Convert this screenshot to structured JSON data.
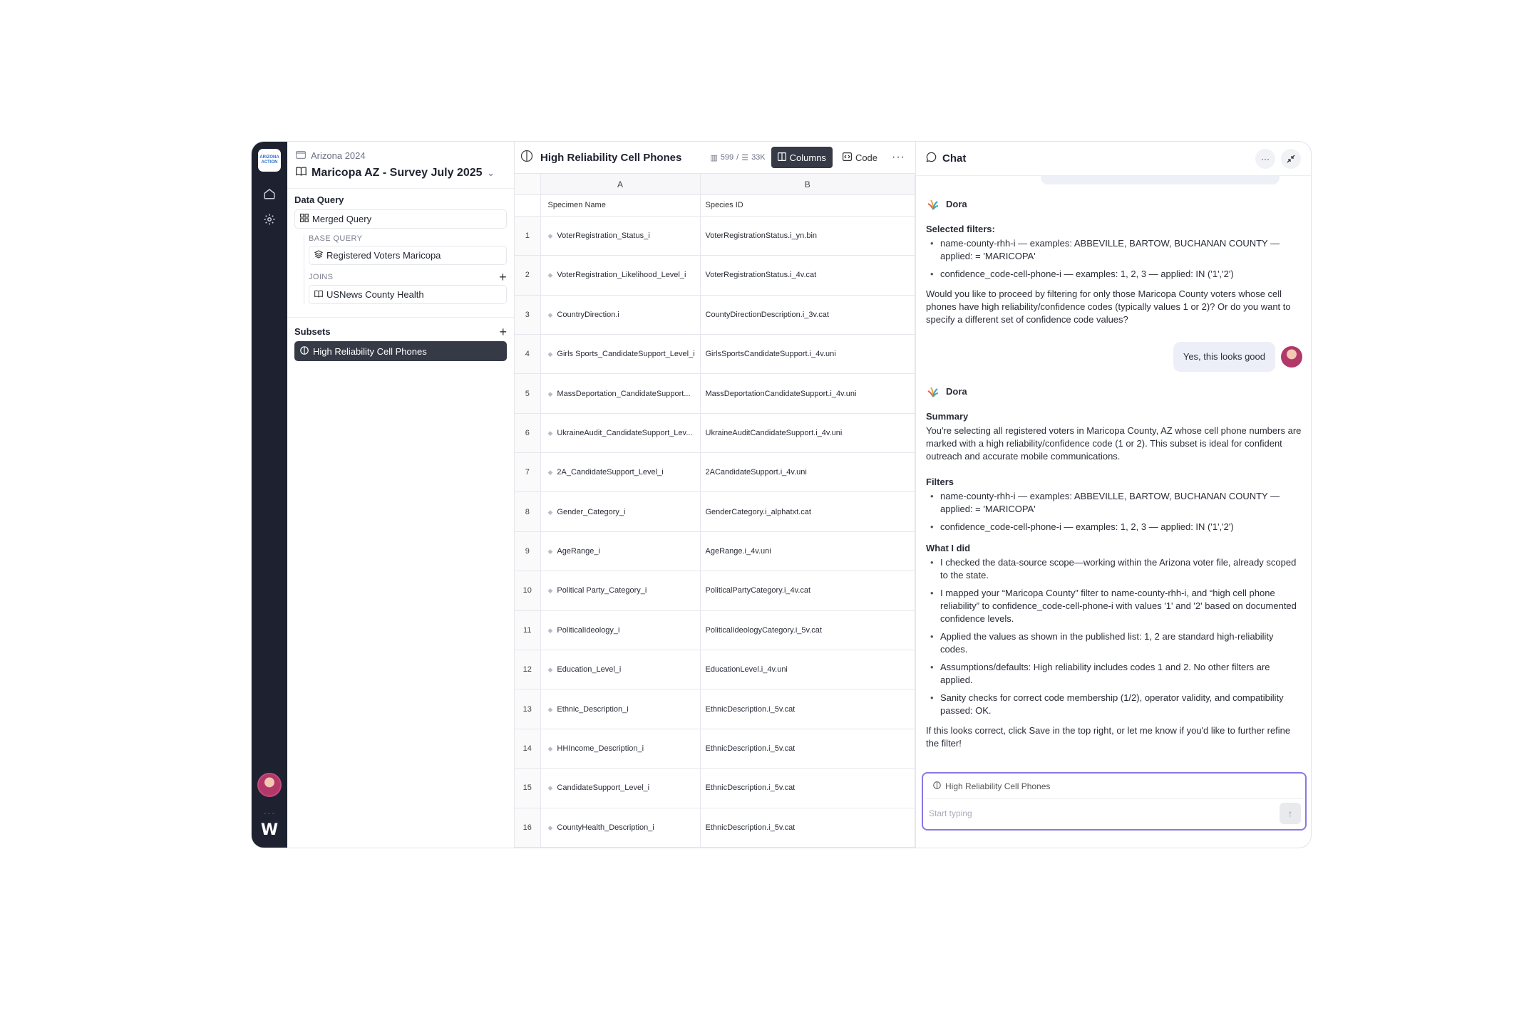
{
  "rail": {
    "logo_text": "ARIZONA ACTION",
    "nav": [
      "home-icon",
      "settings-icon"
    ],
    "dots": "···",
    "brand_mark": "W"
  },
  "query_panel": {
    "breadcrumb": "Arizona 2024",
    "project": "Maricopa AZ - Survey July 2025",
    "data_query_title": "Data Query",
    "merged_query": "Merged Query",
    "base_query_label": "BASE QUERY",
    "base_query": "Registered Voters Maricopa",
    "joins_label": "JOINS",
    "join_item": "USNews County Health",
    "subsets_title": "Subsets",
    "active_subset": "High Reliability Cell Phones"
  },
  "grid": {
    "title": "High Reliability Cell Phones",
    "row_count": "599",
    "separator": "/",
    "total_count": "33K",
    "columns_button": "Columns",
    "code_button": "Code",
    "more": "···",
    "col_letters": [
      "A",
      "B"
    ],
    "headers": [
      "Specimen Name",
      "Species ID"
    ],
    "rows": [
      {
        "n": "1",
        "a": "VoterRegistration_Status_i",
        "b": "VoterRegistrationStatus.i_yn.bin"
      },
      {
        "n": "2",
        "a": "VoterRegistration_Likelihood_Level_i",
        "b": "VoterRegistrationStatus.i_4v.cat"
      },
      {
        "n": "3",
        "a": "CountryDirection.i",
        "b": "CountyDirectionDescription.i_3v.cat"
      },
      {
        "n": "4",
        "a": "Girls Sports_CandidateSupport_Level_i",
        "b": "GirlsSportsCandidateSupport.i_4v.uni"
      },
      {
        "n": "5",
        "a": "MassDeportation_CandidateSupport...",
        "b": "MassDeportationCandidateSupport.i_4v.uni"
      },
      {
        "n": "6",
        "a": "UkraineAudit_CandidateSupport_Lev...",
        "b": "UkraineAuditCandidateSupport.i_4v.uni"
      },
      {
        "n": "7",
        "a": "2A_CandidateSupport_Level_i",
        "b": "2ACandidateSupport.i_4v.uni"
      },
      {
        "n": "8",
        "a": "Gender_Category_i",
        "b": "GenderCategory.i_alphatxt.cat"
      },
      {
        "n": "9",
        "a": "AgeRange_i",
        "b": "AgeRange.i_4v.uni"
      },
      {
        "n": "10",
        "a": "Political Party_Category_i",
        "b": "PoliticalPartyCategory.i_4v.cat"
      },
      {
        "n": "11",
        "a": "PoliticalIdeology_i",
        "b": "PoliticalIdeologyCategory.i_5v.cat"
      },
      {
        "n": "12",
        "a": "Education_Level_i",
        "b": "EducationLevel.i_4v.uni"
      },
      {
        "n": "13",
        "a": "Ethnic_Description_i",
        "b": "EthnicDescription.i_5v.cat"
      },
      {
        "n": "14",
        "a": "HHIncome_Description_i",
        "b": "EthnicDescription.i_5v.cat"
      },
      {
        "n": "15",
        "a": "CandidateSupport_Level_i",
        "b": "EthnicDescription.i_5v.cat"
      },
      {
        "n": "16",
        "a": "CountyHealth_Description_i",
        "b": "EthnicDescription.i_5v.cat"
      }
    ]
  },
  "chat": {
    "title": "Chat",
    "more": "···",
    "assistant_name": "Dora",
    "msg1": {
      "heading": "Selected filters:",
      "filters": [
        "name-county-rhh-i — examples: ABBEVILLE, BARTOW, BUCHANAN COUNTY — applied: = 'MARICOPA'",
        "confidence_code-cell-phone-i — examples: 1, 2, 3 — applied: IN ('1','2')"
      ],
      "question": "Would you like to proceed by filtering for only those Maricopa County voters whose cell phones have high reliability/confidence codes (typically values 1 or 2)? Or do you want to specify a different set of confidence code values?"
    },
    "user_reply": "Yes, this looks good",
    "msg2": {
      "summary_heading": "Summary",
      "summary": "You're selecting all registered voters in Maricopa County, AZ whose cell phone numbers are marked with a high reliability/confidence code (1 or 2). This subset is ideal for confident outreach and accurate mobile communications.",
      "filters_heading": "Filters",
      "filters": [
        "name-county-rhh-i — examples: ABBEVILLE, BARTOW, BUCHANAN COUNTY — applied: = 'MARICOPA'",
        "confidence_code-cell-phone-i — examples: 1, 2, 3 — applied: IN ('1','2')"
      ],
      "did_heading": "What I did",
      "did": [
        "I checked the data-source scope—working within the Arizona voter file, already scoped to the state.",
        "I mapped your “Maricopa County” filter to name-county-rhh-i, and “high cell phone reliability” to confidence_code-cell-phone-i with values '1' and '2' based on documented confidence levels.",
        "Applied the values as shown in the published list: 1, 2 are standard high-reliability codes.",
        "Assumptions/defaults: High reliability includes codes 1 and 2. No other filters are applied.",
        "Sanity checks for correct code membership (1/2), operator validity, and compatibility passed: OK."
      ],
      "closing": "If this looks correct, click Save in the top right, or let me know if you'd like to further refine the filter!"
    },
    "composer": {
      "context_chip": "High Reliability Cell Phones",
      "placeholder": "Start typing"
    }
  }
}
